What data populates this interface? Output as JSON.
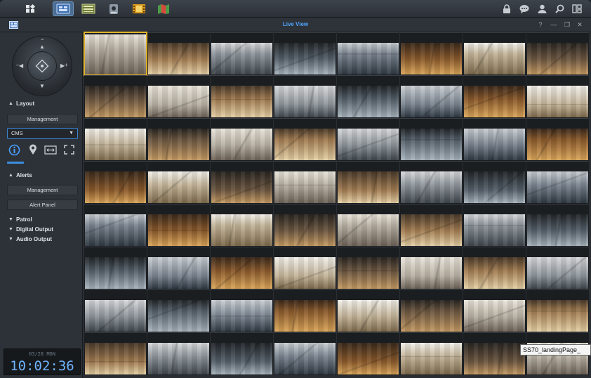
{
  "dock": {
    "apps": [
      "main-menu",
      "live-view",
      "timeline",
      "ip-camera",
      "recording",
      "e-map"
    ],
    "right_icons": [
      "lock-icon",
      "chat-icon",
      "user-icon",
      "search-icon",
      "widget-icon"
    ]
  },
  "window": {
    "title": "Live View"
  },
  "sidebar": {
    "layout_header": "Layout",
    "layout_management": "Management",
    "layout_select_value": "CMS",
    "alerts_header": "Alerts",
    "alerts_management": "Management",
    "alert_panel": "Alert Panel",
    "patrol": "Patrol",
    "digital_output": "Digital Output",
    "audio_output": "Audio Output"
  },
  "clock": {
    "date": "03/28 MON",
    "time": "10:02:36"
  },
  "tooltip": "SS70_landingPage_",
  "grid": {
    "rows": 8,
    "cols": 8
  }
}
